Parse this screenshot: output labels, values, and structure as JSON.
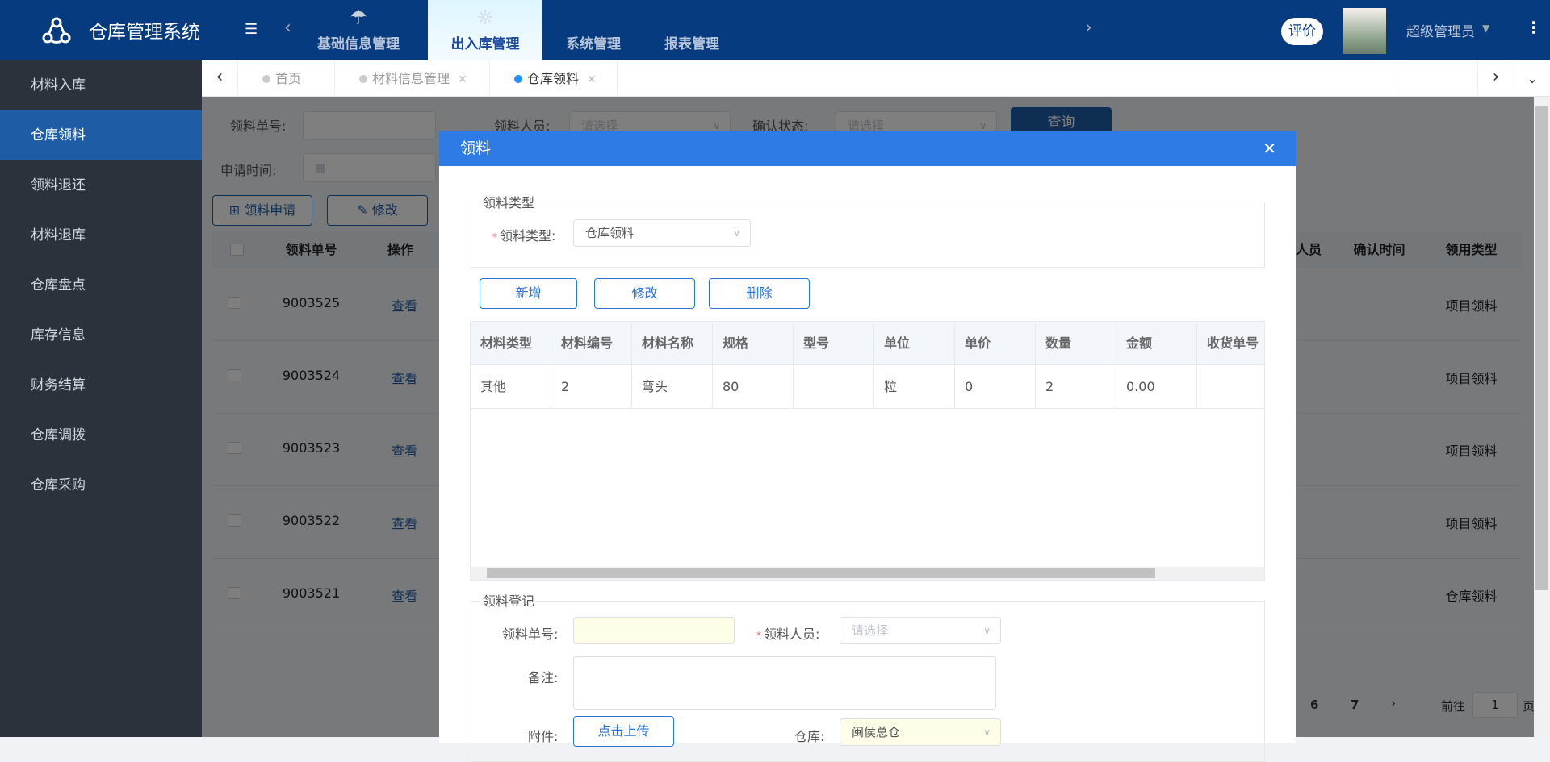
{
  "app": {
    "title": "仓库管理系统"
  },
  "topnav": {
    "items": [
      {
        "label": "基础信息管理",
        "icon": "umbrella-icon"
      },
      {
        "label": "出入库管理",
        "icon": "sun-icon",
        "active": true
      },
      {
        "label": "系统管理"
      },
      {
        "label": "报表管理"
      }
    ]
  },
  "user": {
    "rate_label": "评价",
    "name": "超级管理员"
  },
  "sidebar": {
    "items": [
      {
        "label": "材料入库"
      },
      {
        "label": "仓库领料",
        "active": true
      },
      {
        "label": "领料退还"
      },
      {
        "label": "材料退库"
      },
      {
        "label": "仓库盘点"
      },
      {
        "label": "库存信息"
      },
      {
        "label": "财务结算"
      },
      {
        "label": "仓库调拨"
      },
      {
        "label": "仓库采购"
      }
    ]
  },
  "tabs": [
    {
      "label": "首页"
    },
    {
      "label": "材料信息管理",
      "closable": true
    },
    {
      "label": "仓库领料",
      "closable": true,
      "active": true
    }
  ],
  "filters": {
    "order_no_label": "领料单号:",
    "person_label": "领料人员:",
    "person_placeholder": "请选择",
    "status_label": "确认状态:",
    "status_placeholder": "请选择",
    "query_label": "查询",
    "date_label": "申请时间:"
  },
  "actions": {
    "apply_label": "领料申请",
    "edit_label": "修改"
  },
  "bg_table": {
    "headers": [
      "领料单号",
      "操作",
      "人员",
      "确认时间",
      "领用类型"
    ],
    "rows": [
      {
        "no": "9003525",
        "op": "查看",
        "type": "项目领料"
      },
      {
        "no": "9003524",
        "op": "查看",
        "type": "项目领料"
      },
      {
        "no": "9003523",
        "op": "查看",
        "type": "项目领料"
      },
      {
        "no": "9003522",
        "op": "查看",
        "type": "项目领料"
      },
      {
        "no": "9003521",
        "op": "查看",
        "type": "仓库领料"
      }
    ]
  },
  "pagination": {
    "pages": [
      "6",
      "7"
    ],
    "goto_label": "前往",
    "page_value": "1",
    "page_suffix": "页"
  },
  "modal": {
    "title": "领料",
    "type_section": {
      "legend": "领料类型",
      "label": "领料类型:",
      "value": "仓库领料"
    },
    "buttons": {
      "add": "新增",
      "edit": "修改",
      "delete": "删除"
    },
    "table": {
      "headers": [
        "材料类型",
        "材料编号",
        "材料名称",
        "规格",
        "型号",
        "单位",
        "单价",
        "数量",
        "金额",
        "收货单号"
      ],
      "rows": [
        [
          "其他",
          "2",
          "弯头",
          "80",
          "",
          "粒",
          "0",
          "2",
          "0.00",
          ""
        ]
      ]
    },
    "register": {
      "legend": "领料登记",
      "order_no_label": "领料单号:",
      "order_no_value": "",
      "person_label": "领料人员:",
      "person_placeholder": "请选择",
      "remark_label": "备注:",
      "attach_label": "附件:",
      "upload_label": "点击上传",
      "warehouse_label": "仓库:",
      "warehouse_value": "闽侯总仓"
    }
  },
  "colors": {
    "header": "#073b80",
    "sidebar": "#2b323c",
    "sidebar_active": "#1f5ca6",
    "modal_title": "#2f7be5",
    "primary": "#2a74d8"
  }
}
